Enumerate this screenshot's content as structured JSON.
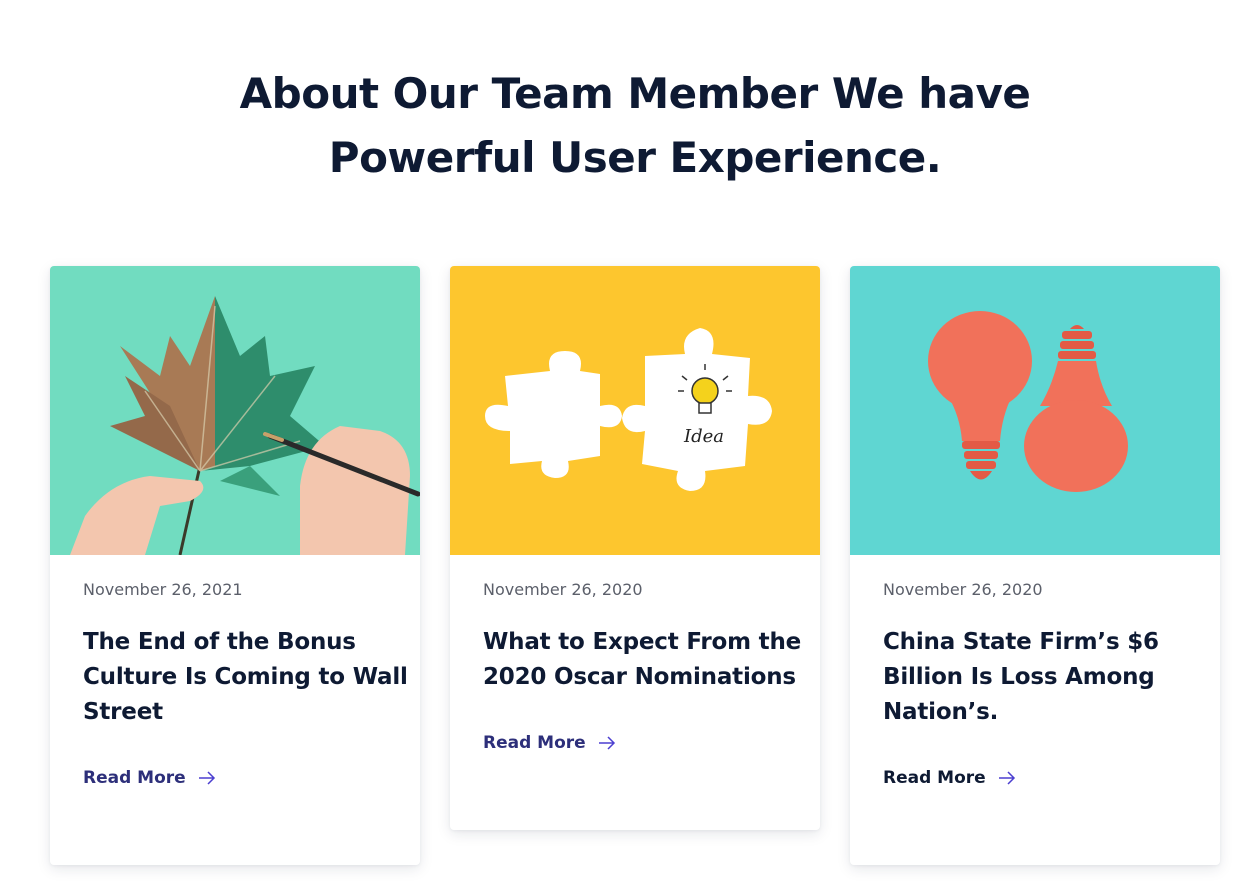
{
  "heading": {
    "line1": "About Our Team Member We have",
    "line2": "Powerful User Experience."
  },
  "posts": [
    {
      "date": "November 26, 2021",
      "title": "The End of the Bonus Culture Is Coming to Wall Street",
      "read_more": "Read More",
      "image": "leaf-painting-image",
      "bg_color": "#71dcc0"
    },
    {
      "date": "November 26, 2020",
      "title": "What to Expect From the 2020 Oscar Nominations",
      "read_more": "Read More",
      "image": "puzzle-idea-image",
      "image_text": "Idea",
      "bg_color": "#fdc62e"
    },
    {
      "date": "November 26, 2020",
      "title": "China State Firm’s $6 Billion Is Loss Among Nation’s.",
      "read_more": "Read More",
      "image": "red-lightbulbs-image",
      "bg_color": "#5fd6d2"
    }
  ],
  "colors": {
    "heading": "#0e1a33",
    "link": "#2d2f7a",
    "date": "#5b5f6a"
  }
}
